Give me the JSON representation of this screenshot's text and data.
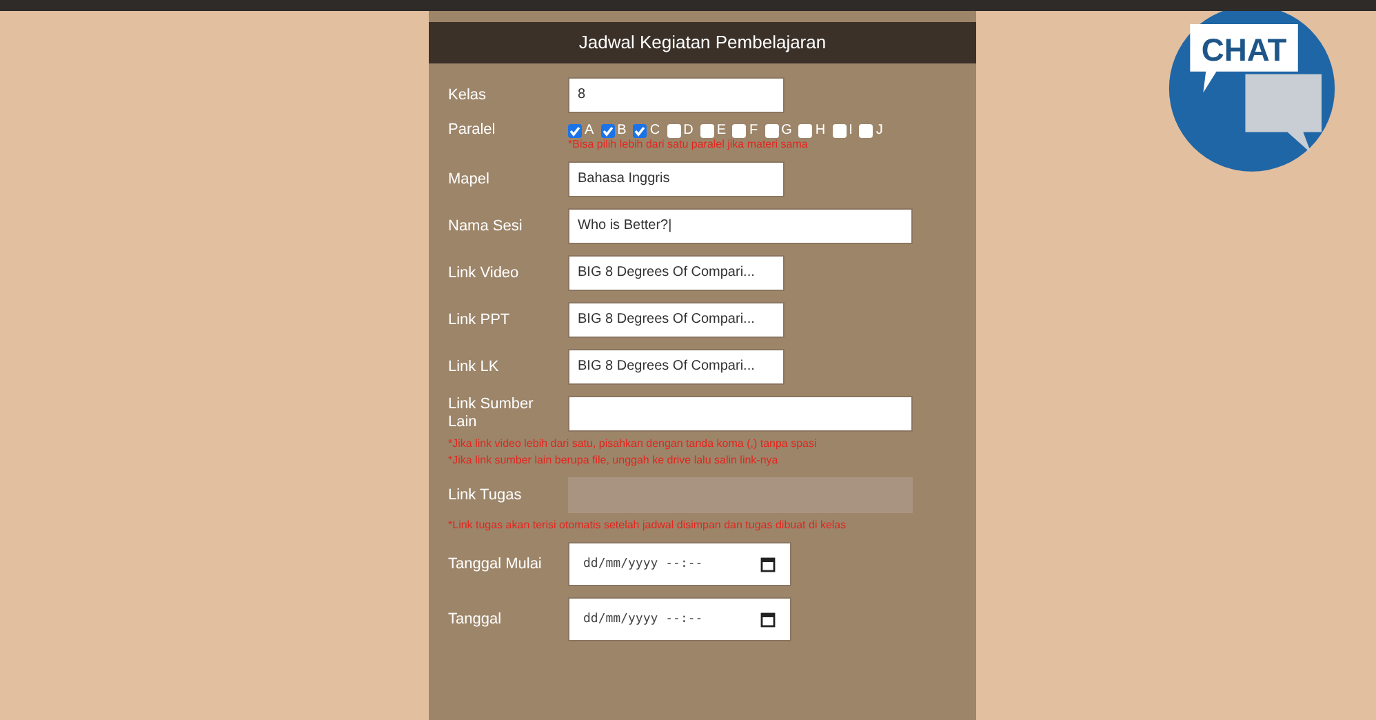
{
  "form": {
    "title": "Jadwal Kegiatan Pembelajaran",
    "fields": [
      {
        "kind": "text",
        "label": "Kelas",
        "value": "8"
      },
      {
        "kind": "checks",
        "label": "Paralel",
        "options": [
          {
            "label": "A",
            "checked": true
          },
          {
            "label": "B",
            "checked": true
          },
          {
            "label": "C",
            "checked": true
          },
          {
            "label": "D",
            "checked": false
          },
          {
            "label": "E",
            "checked": false
          },
          {
            "label": "F",
            "checked": false
          },
          {
            "label": "G",
            "checked": false
          },
          {
            "label": "H",
            "checked": false
          },
          {
            "label": "I",
            "checked": false
          },
          {
            "label": "J",
            "checked": false
          }
        ]
      },
      {
        "kind": "note",
        "lines": [
          "*Bisa pilih lebih dari satu paralel jika materi sama"
        ]
      },
      {
        "kind": "text",
        "label": "Mapel",
        "value": "Bahasa Inggris"
      },
      {
        "kind": "longtext",
        "label": "Nama Sesi",
        "value": "Who is Better?|"
      },
      {
        "kind": "text",
        "label": "Link Video",
        "value": "BIG 8 Degrees Of Compari..."
      },
      {
        "kind": "text",
        "label": "Link PPT",
        "value": "BIG 8 Degrees Of Compari..."
      },
      {
        "kind": "text",
        "label": "Link LK",
        "value": "BIG 8 Degrees Of Compari..."
      },
      {
        "kind": "longtext",
        "label": "Link Sumber Lain"
      },
      {
        "kind": "note",
        "lines": [
          "*Jika link video lebih dari satu, pisahkan dengan tanda koma (,) tanpa spasi",
          "*Jika link sumber lain berupa file, unggah ke drive lalu salin link-nya"
        ]
      },
      {
        "kind": "disabled",
        "label": "Link Tugas"
      },
      {
        "kind": "note",
        "lines": [
          "*Link tugas akan terisi otomatis setelah jadwal disimpan dan tugas dibuat di kelas"
        ]
      },
      {
        "kind": "date",
        "label": "Tanggal Mulai",
        "value": "dd/mm/yyyy --:--"
      },
      {
        "kind": "date",
        "label": "Tanggal",
        "value": "dd/mm/yyyy --:--"
      }
    ]
  },
  "chat_button": {
    "label": "CHAT"
  }
}
